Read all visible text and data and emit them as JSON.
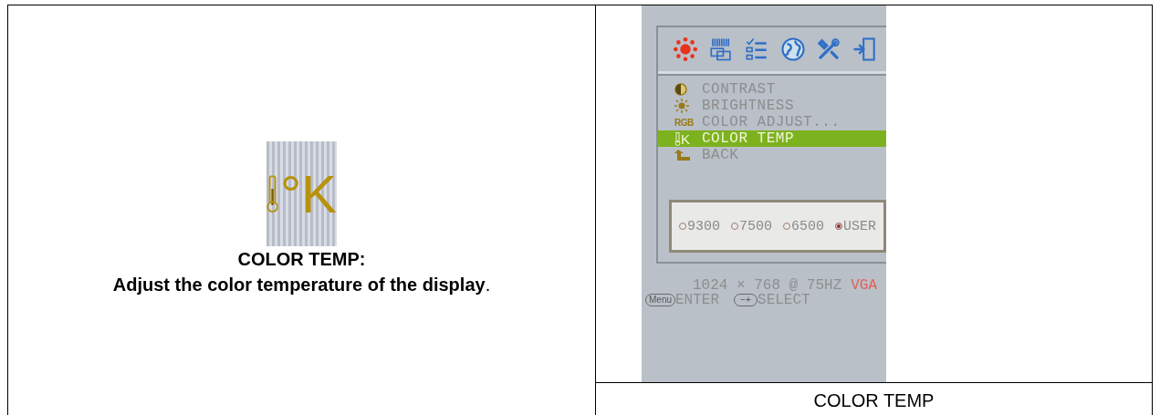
{
  "description": {
    "icon_text": "°K",
    "heading": "COLOR TEMP:",
    "body": "**Adjust the color temperature of the display**."
  },
  "osd": {
    "tabs": [
      {
        "kind": "sun",
        "selected": true
      },
      {
        "kind": "image",
        "selected": false
      },
      {
        "kind": "checklist",
        "selected": false
      },
      {
        "kind": "globe",
        "selected": false
      },
      {
        "kind": "tools",
        "selected": false
      },
      {
        "kind": "exit",
        "selected": false
      }
    ],
    "menu": [
      {
        "kind": "contrast",
        "label": "CONTRAST",
        "selected": false
      },
      {
        "kind": "sun",
        "label": "BRIGHTNESS",
        "selected": false
      },
      {
        "kind": "rgb",
        "icon_text": "RGB",
        "label": "COLOR ADJUST...",
        "selected": false
      },
      {
        "kind": "thermometer",
        "icon_text": "K",
        "label": "COLOR TEMP",
        "selected": true
      },
      {
        "kind": "back",
        "label": "BACK",
        "selected": false
      }
    ],
    "options": [
      {
        "label": "9300",
        "selected": false
      },
      {
        "label": "7500",
        "selected": false
      },
      {
        "label": "6500",
        "selected": false
      },
      {
        "label": "USER",
        "selected": true
      }
    ],
    "resolution": "1024 × 768 @ 75HZ",
    "input": "VGA",
    "hints": [
      {
        "key": "Menu",
        "label": "ENTER"
      },
      {
        "key": "−+",
        "label": "SELECT"
      }
    ]
  },
  "caption": "COLOR TEMP"
}
